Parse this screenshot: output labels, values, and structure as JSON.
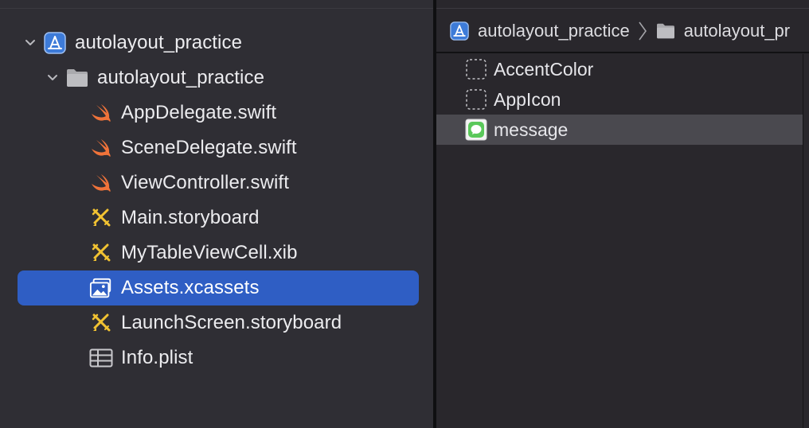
{
  "navigator": {
    "items": [
      {
        "label": "autolayout_practice",
        "icon": "xcode-project-icon",
        "disclosure": "expanded"
      },
      {
        "label": "autolayout_practice",
        "icon": "folder-icon",
        "disclosure": "expanded"
      },
      {
        "label": "AppDelegate.swift",
        "icon": "swift-file-icon"
      },
      {
        "label": "SceneDelegate.swift",
        "icon": "swift-file-icon"
      },
      {
        "label": "ViewController.swift",
        "icon": "swift-file-icon"
      },
      {
        "label": "Main.storyboard",
        "icon": "storyboard-icon"
      },
      {
        "label": "MyTableViewCell.xib",
        "icon": "storyboard-icon"
      },
      {
        "label": "Assets.xcassets",
        "icon": "asset-catalog-icon",
        "selected": true
      },
      {
        "label": "LaunchScreen.storyboard",
        "icon": "storyboard-icon"
      },
      {
        "label": "Info.plist",
        "icon": "plist-table-icon"
      }
    ]
  },
  "jumpbar": {
    "crumbs": [
      {
        "label": "autolayout_practice",
        "icon": "xcode-project-icon"
      },
      {
        "label": "autolayout_pr",
        "icon": "folder-icon"
      }
    ]
  },
  "assets": {
    "items": [
      {
        "label": "AccentColor",
        "icon": "color-set-icon"
      },
      {
        "label": "AppIcon",
        "icon": "app-icon-set-icon"
      },
      {
        "label": "message",
        "icon": "image-set-icon",
        "selected": true
      }
    ]
  },
  "colors": {
    "selection": "#2f5ec4",
    "swift": "#f0733a",
    "storyboard": "#f1c232",
    "project": "#4a86e8",
    "background": "#2f2e34"
  }
}
